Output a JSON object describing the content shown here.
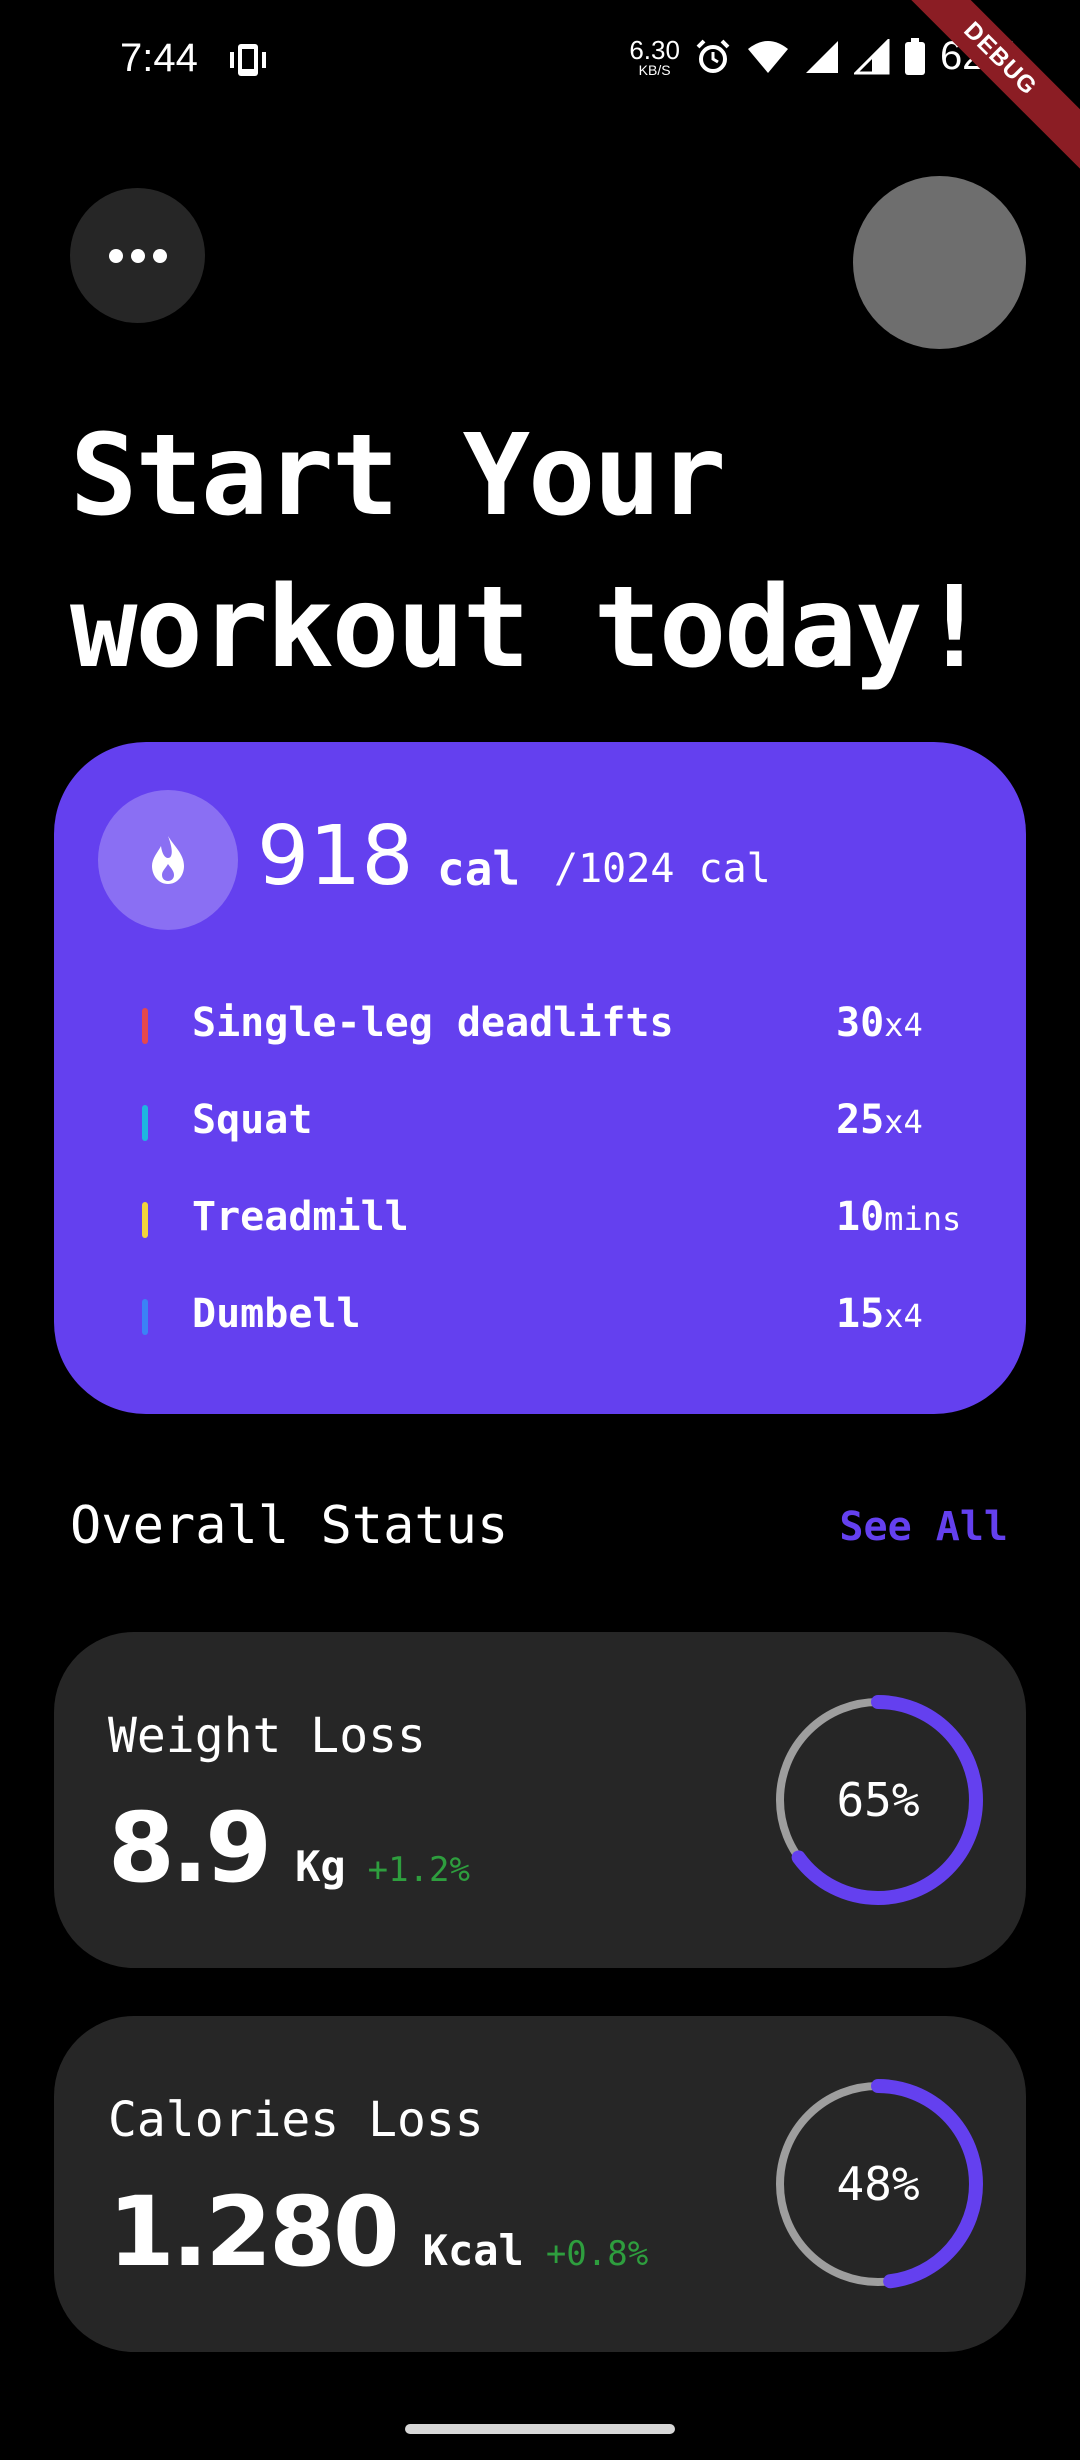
{
  "status_bar": {
    "time": "7:44",
    "net_speed_value": "6.30",
    "net_speed_unit": "KB/S",
    "battery_percent": "62%",
    "debug_label": "DEBUG"
  },
  "header": {
    "menu_icon": "more-horizontal-icon",
    "headline_line1": "Start Your",
    "headline_line2": "workout today!"
  },
  "calorie_card": {
    "icon": "flame-icon",
    "current": "918",
    "unit": "cal",
    "goal": "/1024 cal",
    "exercises": [
      {
        "name": "Single-leg deadlifts",
        "count": "30",
        "unit": "x4",
        "color": "#e5484d"
      },
      {
        "name": "Squat",
        "count": "25",
        "unit": "x4",
        "color": "#1fb5e0"
      },
      {
        "name": "Treadmill",
        "count": "10",
        "unit": "mins",
        "color": "#f2d43c"
      },
      {
        "name": "Dumbell",
        "count": "15",
        "unit": "x4",
        "color": "#3b82f6"
      }
    ]
  },
  "overall_status": {
    "title": "Overall Status",
    "see_all": "See All",
    "cards": [
      {
        "label": "Weight Loss",
        "value": "8.9",
        "unit": "Kg",
        "delta": "+1.2%",
        "percent_label": "65%",
        "progress": 0.65
      },
      {
        "label": "Calories Loss",
        "value": "1.280",
        "unit": "Kcal",
        "delta": "+0.8%",
        "percent_label": "48%",
        "progress": 0.48
      }
    ]
  },
  "colors": {
    "accent": "#6440ef",
    "card_bg": "#262626",
    "positive": "#2e9e3e",
    "ring_track": "#9e9e9e"
  }
}
